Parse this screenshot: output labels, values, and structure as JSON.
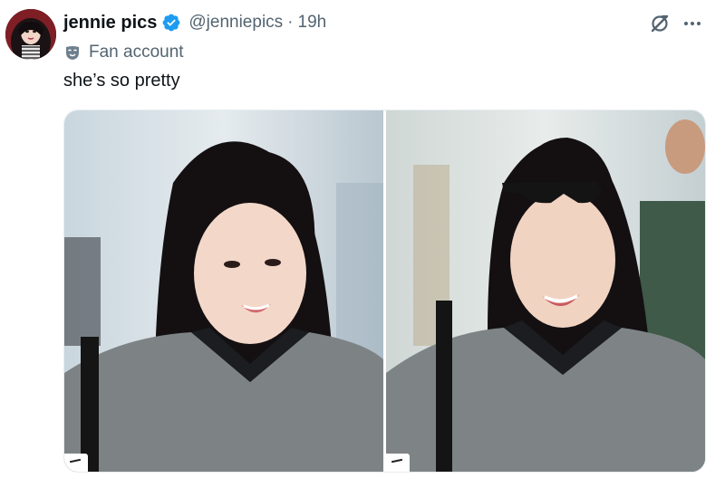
{
  "tweet": {
    "display_name": "jennie pics",
    "handle": "@jenniepics",
    "separator": "·",
    "time": "19h",
    "affiliation": "Fan account",
    "text": "she’s so pretty",
    "verified": true
  },
  "icons": {
    "verified": "verified-badge-icon",
    "affiliation": "mask-icon",
    "grok": "grok-icon",
    "more": "more-options-icon"
  },
  "colors": {
    "verified_blue": "#1d9bf0",
    "muted_text": "#536471",
    "primary_text": "#0f1419"
  },
  "media": {
    "photo_count": 2
  }
}
